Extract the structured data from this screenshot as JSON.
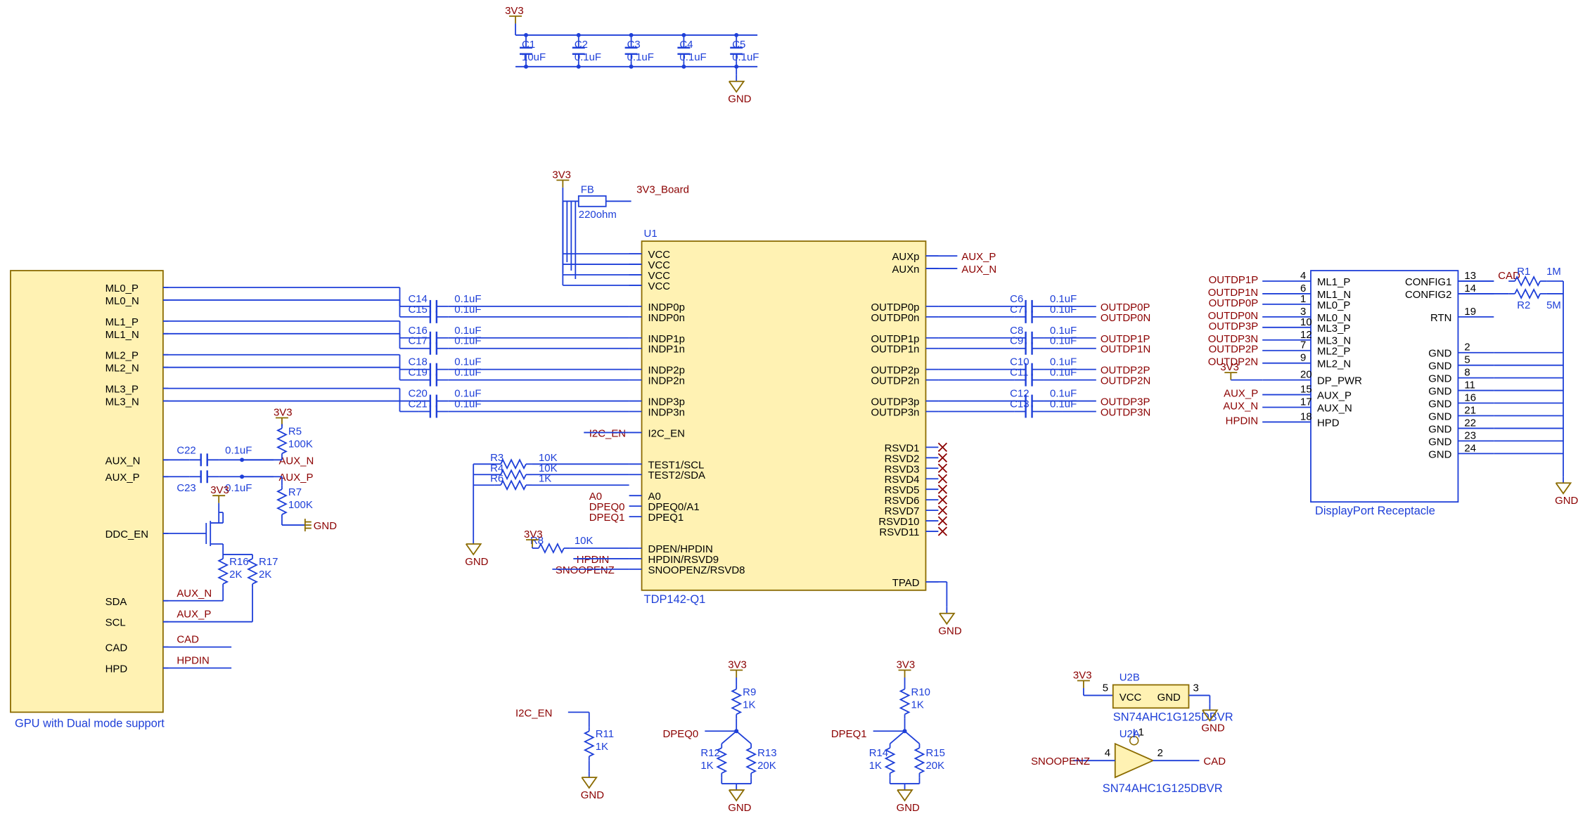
{
  "rails": {
    "v33": "3V3",
    "v33b": "3V3_Board",
    "gnd": "GND"
  },
  "gpu": {
    "title": "GPU with Dual mode support",
    "pins": [
      "ML0_P",
      "ML0_N",
      "ML1_P",
      "ML1_N",
      "ML2_P",
      "ML2_N",
      "ML3_P",
      "ML3_N",
      "AUX_N",
      "AUX_P",
      "DDC_EN",
      "SDA",
      "SCL",
      "CAD",
      "HPD"
    ]
  },
  "decouple": {
    "caps": [
      {
        "ref": "C1",
        "val": "10uF"
      },
      {
        "ref": "C2",
        "val": "0.1uF"
      },
      {
        "ref": "C3",
        "val": "0.1uF"
      },
      {
        "ref": "C4",
        "val": "0.1uF"
      },
      {
        "ref": "C5",
        "val": "0.1uF"
      }
    ]
  },
  "fb": {
    "ref": "FB",
    "val": "220ohm"
  },
  "u1": {
    "ref": "U1",
    "part": "TDP142-Q1",
    "left": [
      {
        "pin": "VCC"
      },
      {
        "pin": "VCC"
      },
      {
        "pin": "VCC"
      },
      {
        "pin": "VCC"
      },
      {
        "pin": "INDP0p"
      },
      {
        "pin": "INDP0n"
      },
      {
        "pin": "INDP1p"
      },
      {
        "pin": "INDP1n"
      },
      {
        "pin": "INDP2p"
      },
      {
        "pin": "INDP2n"
      },
      {
        "pin": "INDP3p"
      },
      {
        "pin": "INDP3n"
      },
      {
        "pin": "I2C_EN"
      },
      {
        "pin": "TEST1/SCL"
      },
      {
        "pin": "TEST2/SDA"
      },
      {
        "pin": "A0"
      },
      {
        "pin": "DPEQ0/A1"
      },
      {
        "pin": "DPEQ1"
      },
      {
        "pin": "DPEN/HPDIN"
      },
      {
        "pin": "HPDIN/RSVD9"
      },
      {
        "pin": "SNOOPENZ/RSVD8"
      }
    ],
    "right": [
      {
        "pin": "AUXp"
      },
      {
        "pin": "AUXn"
      },
      {
        "pin": "OUTDP0p"
      },
      {
        "pin": "OUTDP0n"
      },
      {
        "pin": "OUTDP1p"
      },
      {
        "pin": "OUTDP1n"
      },
      {
        "pin": "OUTDP2p"
      },
      {
        "pin": "OUTDP2n"
      },
      {
        "pin": "OUTDP3p"
      },
      {
        "pin": "OUTDP3n"
      },
      {
        "pin": "RSVD1"
      },
      {
        "pin": "RSVD2"
      },
      {
        "pin": "RSVD3"
      },
      {
        "pin": "RSVD4"
      },
      {
        "pin": "RSVD5"
      },
      {
        "pin": "RSVD6"
      },
      {
        "pin": "RSVD7"
      },
      {
        "pin": "RSVD10"
      },
      {
        "pin": "RSVD11"
      },
      {
        "pin": "TPAD"
      }
    ]
  },
  "acCapsIn": [
    {
      "ref": "C14",
      "val": "0.1uF"
    },
    {
      "ref": "C15",
      "val": "0.1uF"
    },
    {
      "ref": "C16",
      "val": "0.1uF"
    },
    {
      "ref": "C17",
      "val": "0.1uF"
    },
    {
      "ref": "C18",
      "val": "0.1uF"
    },
    {
      "ref": "C19",
      "val": "0.1uF"
    },
    {
      "ref": "C20",
      "val": "0.1uF"
    },
    {
      "ref": "C21",
      "val": "0.1uF"
    }
  ],
  "acCapsOut": [
    {
      "ref": "C6",
      "val": "0.1uF",
      "net": "OUTDP0P"
    },
    {
      "ref": "C7",
      "val": "0.1uF",
      "net": "OUTDP0N"
    },
    {
      "ref": "C8",
      "val": "0.1uF",
      "net": "OUTDP1P"
    },
    {
      "ref": "C9",
      "val": "0.1uF",
      "net": "OUTDP1N"
    },
    {
      "ref": "C10",
      "val": "0.1uF",
      "net": "OUTDP2P"
    },
    {
      "ref": "C11",
      "val": "0.1uF",
      "net": "OUTDP2N"
    },
    {
      "ref": "C12",
      "val": "0.1uF",
      "net": "OUTDP3P"
    },
    {
      "ref": "C13",
      "val": "0.1uF",
      "net": "OUTDP3N"
    }
  ],
  "aux": {
    "c22": {
      "ref": "C22",
      "val": "0.1uF"
    },
    "c23": {
      "ref": "C23",
      "val": "0.1uF"
    },
    "r5": {
      "ref": "R5",
      "val": "100K"
    },
    "r7": {
      "ref": "R7",
      "val": "100K"
    },
    "r16": {
      "ref": "R16",
      "val": "2K"
    },
    "r17": {
      "ref": "R17",
      "val": "2K"
    },
    "nets": {
      "auxn": "AUX_N",
      "auxp": "AUX_P"
    }
  },
  "cfgRes": [
    {
      "ref": "R3",
      "val": "10K"
    },
    {
      "ref": "R4",
      "val": "10K"
    },
    {
      "ref": "R6",
      "val": "1K"
    },
    {
      "ref": "R8",
      "val": "10K"
    }
  ],
  "cfgNets": {
    "i2c": "I2C_EN",
    "a0": "A0",
    "dpeq0": "DPEQ0",
    "dpeq1": "DPEQ1",
    "hpdin": "HPDIN",
    "snoop": "SNOOPENZ"
  },
  "dividers": {
    "i2c": {
      "net": "I2C_EN",
      "r": {
        "ref": "R11",
        "val": "1K"
      }
    },
    "d0": {
      "net": "DPEQ0",
      "top": {
        "ref": "R9",
        "val": "1K"
      },
      "bl": {
        "ref": "R12",
        "val": "1K"
      },
      "br": {
        "ref": "R13",
        "val": "20K"
      }
    },
    "d1": {
      "net": "DPEQ1",
      "top": {
        "ref": "R10",
        "val": "1K"
      },
      "bl": {
        "ref": "R14",
        "val": "1K"
      },
      "br": {
        "ref": "R15",
        "val": "20K"
      }
    }
  },
  "u2": {
    "refA": "U2A",
    "refB": "U2B",
    "part": "SN74AHC1G125DBVR",
    "pins": {
      "vcc": "VCC",
      "gnd": "GND",
      "num5": "5",
      "num3": "3",
      "num4": "4",
      "num1": "1",
      "num2": "2"
    },
    "nets": {
      "cad": "CAD",
      "snoop": "SNOOPENZ"
    }
  },
  "dp": {
    "title": "DisplayPort Receptacle",
    "left": [
      {
        "net": "OUTDP1P",
        "num": "4",
        "pin": "ML1_P"
      },
      {
        "net": "OUTDP1N",
        "num": "6",
        "pin": "ML1_N"
      },
      {
        "net": "OUTDP0P",
        "num": "1",
        "pin": "ML0_P"
      },
      {
        "net": "OUTDP0N",
        "num": "3",
        "pin": "ML0_N"
      },
      {
        "net": "OUTDP3P",
        "num": "10",
        "pin": "ML3_P"
      },
      {
        "net": "OUTDP3N",
        "num": "12",
        "pin": "ML3_N"
      },
      {
        "net": "OUTDP2P",
        "num": "7",
        "pin": "ML2_P"
      },
      {
        "net": "OUTDP2N",
        "num": "9",
        "pin": "ML2_N"
      },
      {
        "net": "3V3",
        "num": "20",
        "pin": "DP_PWR"
      },
      {
        "net": "AUX_P",
        "num": "15",
        "pin": "AUX_P"
      },
      {
        "net": "AUX_N",
        "num": "17",
        "pin": "AUX_N"
      },
      {
        "net": "HPDIN",
        "num": "18",
        "pin": "HPD"
      }
    ],
    "right": [
      {
        "num": "13",
        "pin": "CONFIG1"
      },
      {
        "num": "14",
        "pin": "CONFIG2"
      },
      {
        "num": "19",
        "pin": "RTN"
      },
      {
        "num": "2",
        "pin": "GND"
      },
      {
        "num": "5",
        "pin": "GND"
      },
      {
        "num": "8",
        "pin": "GND"
      },
      {
        "num": "11",
        "pin": "GND"
      },
      {
        "num": "16",
        "pin": "GND"
      },
      {
        "num": "21",
        "pin": "GND"
      },
      {
        "num": "22",
        "pin": "GND"
      },
      {
        "num": "23",
        "pin": "GND"
      },
      {
        "num": "24",
        "pin": "GND"
      }
    ],
    "r1": {
      "ref": "R1",
      "val": "1M",
      "net": "CAD"
    },
    "r2": {
      "ref": "R2",
      "val": "5M"
    }
  }
}
